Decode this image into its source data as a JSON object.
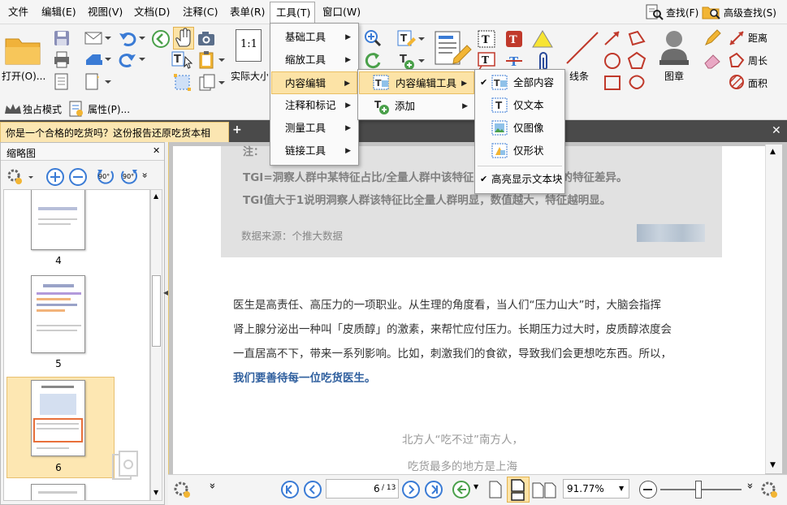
{
  "menubar": {
    "items": [
      "文件",
      "编辑(E)",
      "视图(V)",
      "文档(D)",
      "注释(C)",
      "表单(R)",
      "工具(T)",
      "窗口(W)"
    ],
    "find": "查找(F)",
    "advanced_find": "高级查找(S)"
  },
  "toolbar": {
    "open_label": "打开(O)...",
    "actual_size_label": "实际大小",
    "actual_size_icon_text": "1:1",
    "lines_label": "线条",
    "stamp_label": "图章",
    "distance_label": "距离",
    "perimeter_label": "周长",
    "area_label": "面积"
  },
  "quickbar": {
    "exclusive_mode": "独占模式",
    "properties": "属性(P)..."
  },
  "tab": {
    "title": "你是一个合格的吃货吗？这份报告还原吃货本相"
  },
  "thumbnails": {
    "title": "缩略图",
    "pages": [
      "4",
      "5",
      "6"
    ],
    "rotate_label": "90°"
  },
  "document": {
    "note_cut": "注：",
    "tgi_line1": "TGI=洞察人群中某特征占比/全量人群中该特征占比，比较人群间的特征差异。",
    "tgi_line2": "TGI值大于1说明洞察人群该特征比全量人群明显，数值越大，特征越明显。",
    "source": "数据来源：个推大数据",
    "para_lines": [
      "医生是高责任、高压力的一项职业。从生理的角度看，当人们“压力山大”时，大脑会指挥",
      "肾上腺分泌出一种叫「皮质醇」的激素，来帮忙应付压力。长期压力过大时，皮质醇浓度会",
      "一直居高不下，带来一系列影响。比如，刺激我们的食欲，导致我们会更想吃东西。所以，"
    ],
    "highlight": "我们要善待每一位吃货医生。",
    "sub_line1": "北方人“吃不过”南方人，",
    "sub_line2": "吃货最多的地方是上海"
  },
  "menus": {
    "tools": [
      {
        "label": "基础工具"
      },
      {
        "label": "缩放工具"
      },
      {
        "label": "内容编辑"
      },
      {
        "label": "注释和标记"
      },
      {
        "label": "测量工具"
      },
      {
        "label": "链接工具"
      }
    ],
    "content_edit": [
      {
        "label": "内容编辑工具"
      },
      {
        "label": "添加"
      }
    ],
    "content_edit_tools": [
      {
        "label": "全部内容",
        "checked": true
      },
      {
        "label": "仅文本",
        "checked": false
      },
      {
        "label": "仅图像",
        "checked": false
      },
      {
        "label": "仅形状",
        "checked": false
      },
      {
        "label": "高亮显示文本块",
        "checked": true
      }
    ]
  },
  "statusbar": {
    "page_current": "6",
    "page_total": "/ 13",
    "zoom": "91.77%"
  },
  "colors": {
    "accent": "#3a7bd5",
    "menu_highlight": "#fce3a6",
    "tab_active": "#fbe6b2",
    "link_text": "#2f5f9e"
  }
}
